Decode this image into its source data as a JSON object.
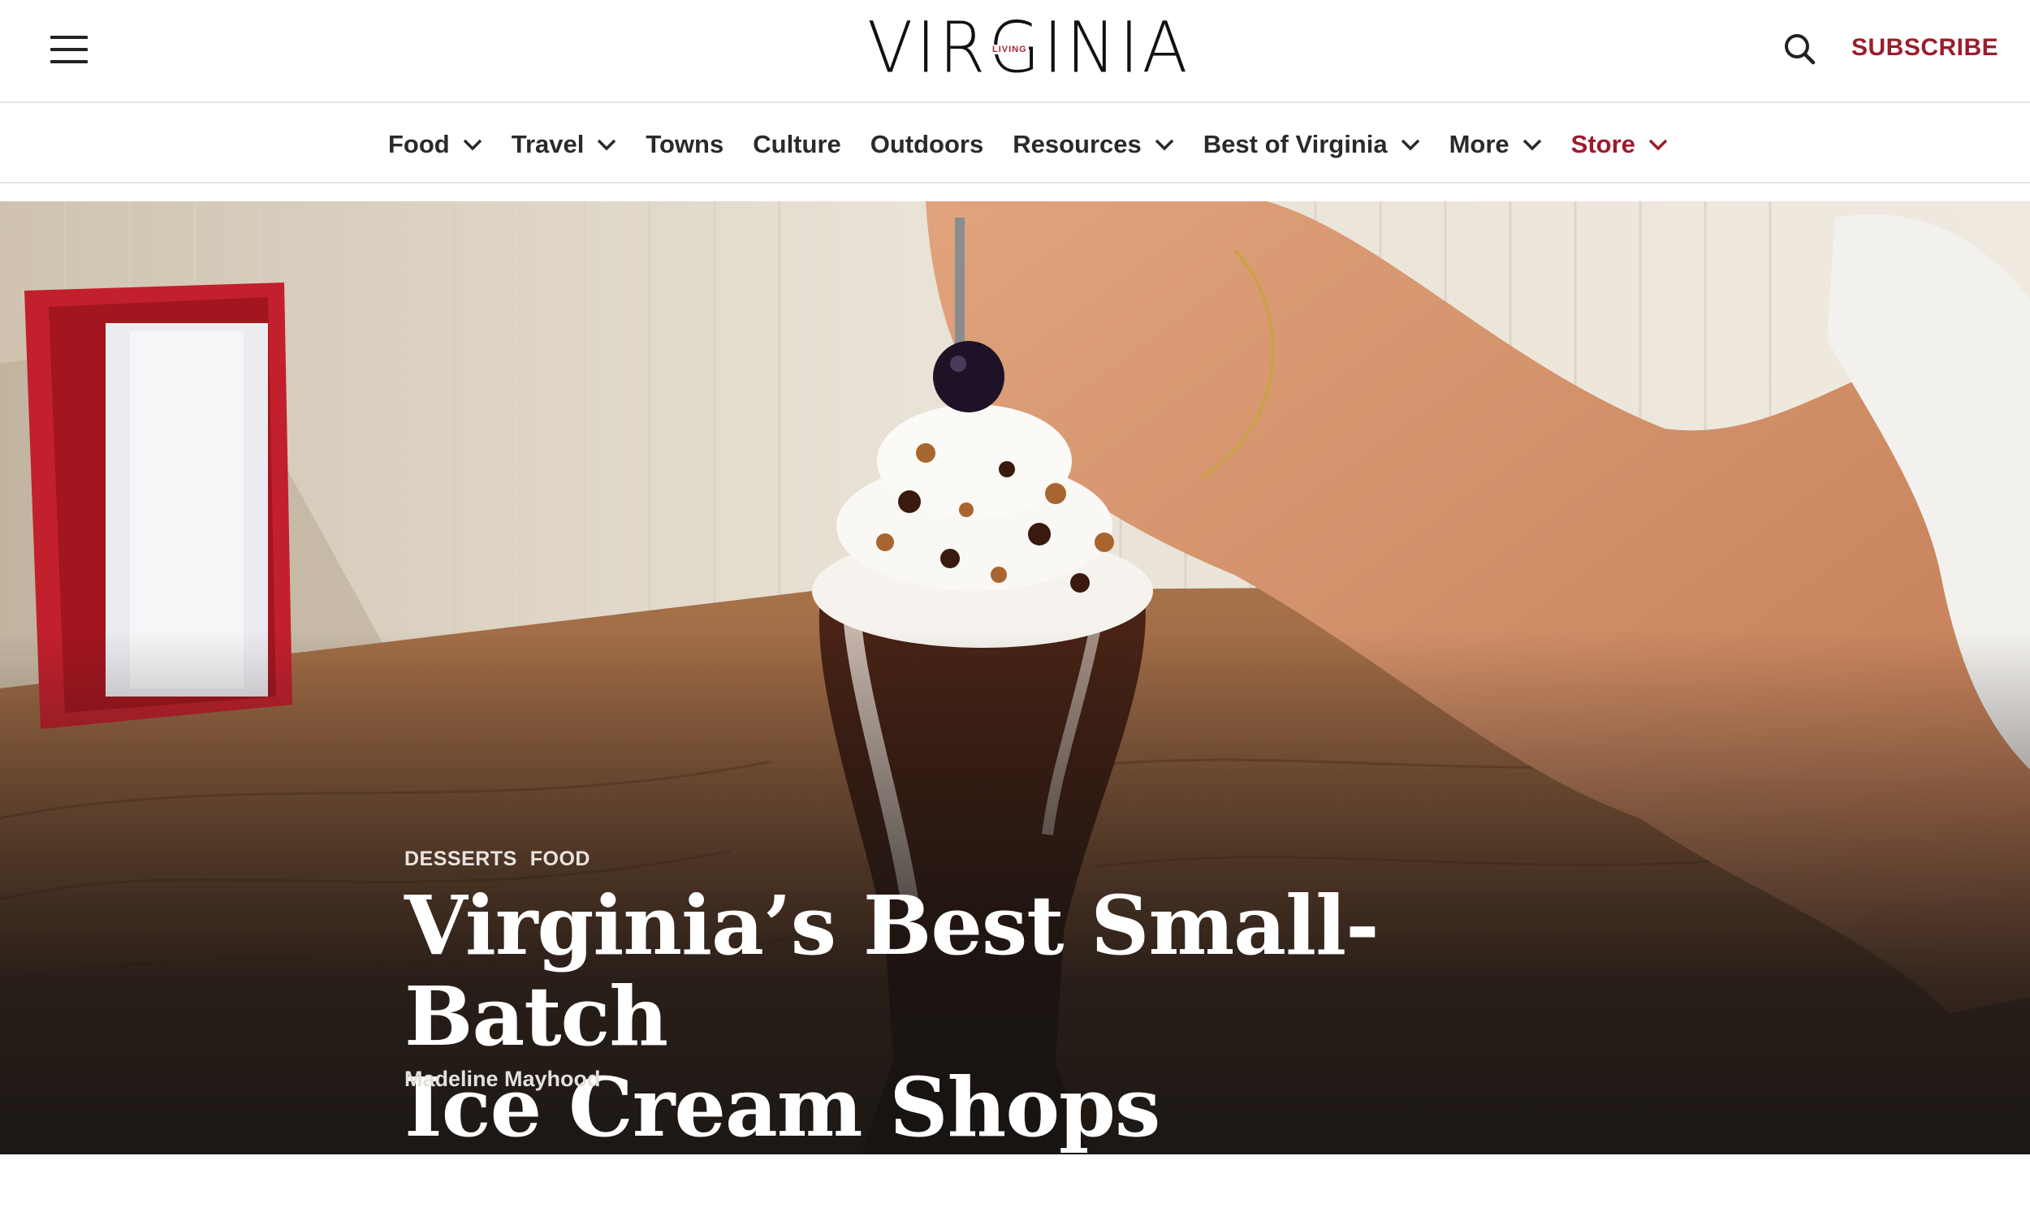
{
  "header": {
    "logo_text": "VIRGINIA",
    "logo_tagline": "LIVING",
    "subscribe_label": "SUBSCRIBE",
    "menu_icon": "hamburger-menu-icon",
    "search_icon": "search-icon",
    "brand_color": "#9b1c2c"
  },
  "nav": {
    "items": [
      {
        "label": "Food",
        "has_dropdown": true
      },
      {
        "label": "Travel",
        "has_dropdown": true
      },
      {
        "label": "Towns",
        "has_dropdown": false
      },
      {
        "label": "Culture",
        "has_dropdown": false
      },
      {
        "label": "Outdoors",
        "has_dropdown": false
      },
      {
        "label": "Resources",
        "has_dropdown": true
      },
      {
        "label": "Best of Virginia",
        "has_dropdown": true
      },
      {
        "label": "More",
        "has_dropdown": true
      },
      {
        "label": "Store",
        "has_dropdown": true
      }
    ]
  },
  "article": {
    "categories": [
      "DESSERTS",
      "FOOD"
    ],
    "title_line1": "Virginia’s Best Small-Batch",
    "title_line2": "Ice Cream Shops",
    "author": "Madeline Mayhood"
  }
}
